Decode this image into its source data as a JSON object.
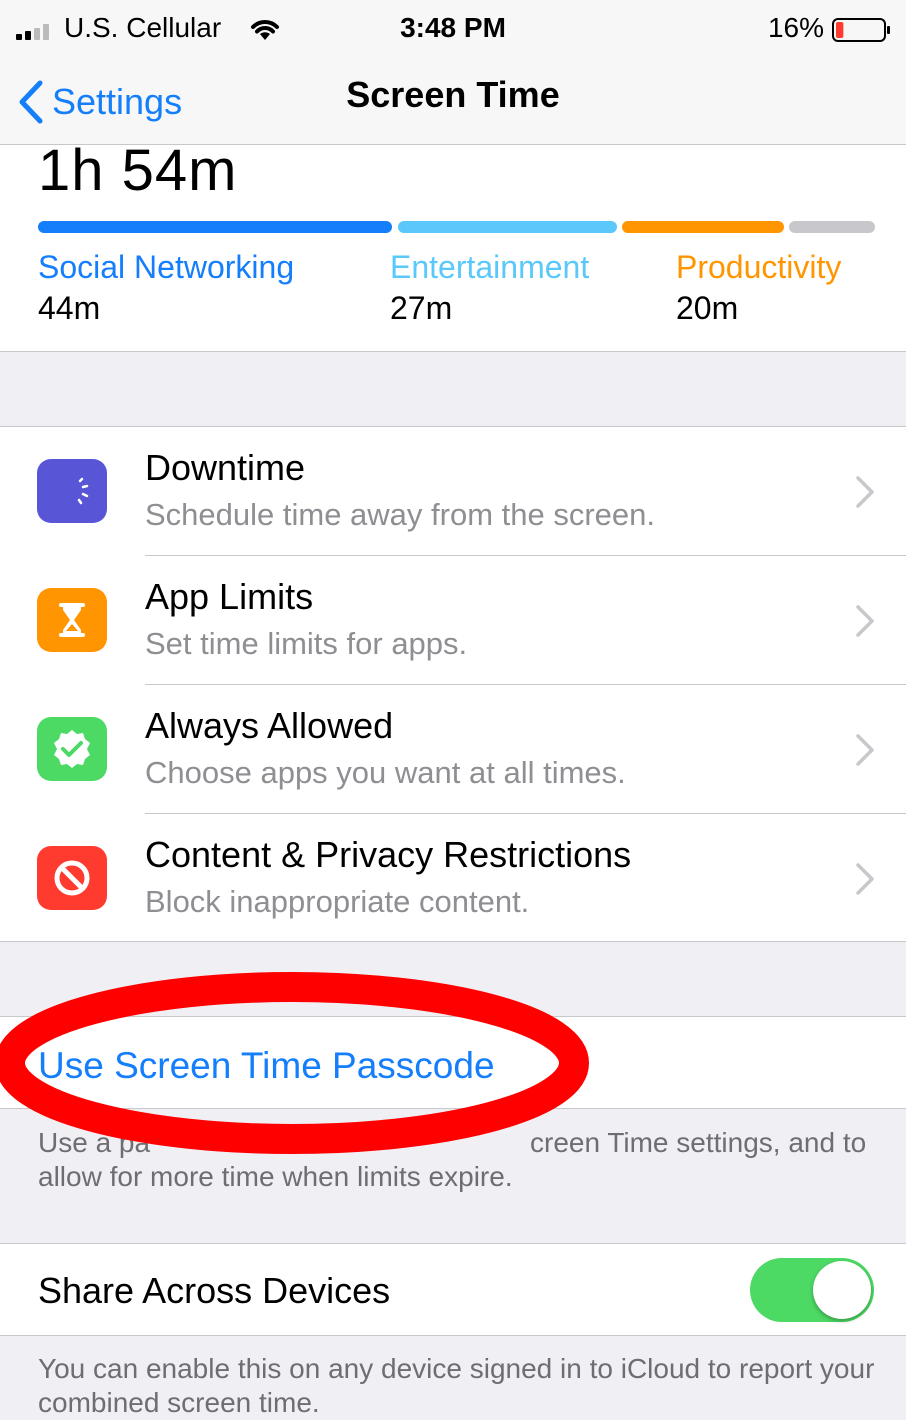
{
  "status_bar": {
    "carrier": "U.S. Cellular",
    "time": "3:48 PM",
    "battery_percent": "16%",
    "battery_level": 0.16,
    "battery_color": "#ff3b30"
  },
  "nav": {
    "back_label": "Settings",
    "title": "Screen Time"
  },
  "usage": {
    "total": "1h 54m",
    "categories": [
      {
        "name": "Social Networking",
        "time": "44m",
        "color": "#147efb"
      },
      {
        "name": "Entertainment",
        "time": "27m",
        "color": "#5ac8fa"
      },
      {
        "name": "Productivity",
        "time": "20m",
        "color": "#ff9500"
      }
    ],
    "other_color": "#c7c7cc"
  },
  "menu": {
    "items": [
      {
        "title": "Downtime",
        "subtitle": "Schedule time away from the screen.",
        "icon": "downtime-icon",
        "color": "#5856d6"
      },
      {
        "title": "App Limits",
        "subtitle": "Set time limits for apps.",
        "icon": "hourglass-icon",
        "color": "#ff9500"
      },
      {
        "title": "Always Allowed",
        "subtitle": "Choose apps you want at all times.",
        "icon": "checkmark-badge-icon",
        "color": "#4cd964"
      },
      {
        "title": "Content & Privacy Restrictions",
        "subtitle": "Block inappropriate content.",
        "icon": "block-icon",
        "color": "#ff3b30"
      }
    ]
  },
  "passcode": {
    "label": "Use Screen Time Passcode",
    "footer_line1_visible": "Use a pa",
    "footer_line1_end_visible": "creen Time settings, and to",
    "footer_line2": "allow for more time when limits expire."
  },
  "share": {
    "label": "Share Across Devices",
    "enabled": true,
    "footer": "You can enable this on any device signed in to iCloud to report your combined screen time."
  },
  "colors": {
    "accent": "#147efb",
    "annotation": "#ff0000",
    "toggle_on": "#4cd964"
  }
}
